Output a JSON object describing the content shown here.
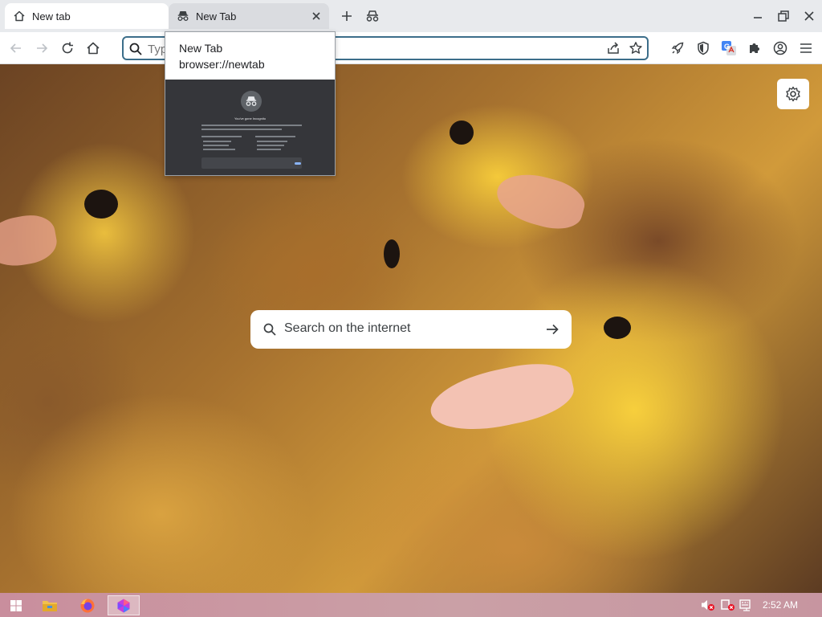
{
  "tabs": [
    {
      "label": "New tab",
      "icon": "home-icon"
    },
    {
      "label": "New Tab",
      "icon": "incognito-icon"
    }
  ],
  "omnibox": {
    "placeholder": "Type"
  },
  "hovercard": {
    "title": "New Tab",
    "url": "browser://newtab",
    "preview": {
      "heading": "You've gone Incognito"
    }
  },
  "newtab": {
    "search_placeholder": "Search on the internet"
  },
  "taskbar": {
    "clock": "2:52 AM"
  },
  "colors": {
    "omnibox_border": "#3c6e8a",
    "active_tab": "#ffffff",
    "incognito_tab": "#dadce0",
    "preview_bg": "#35363a"
  }
}
